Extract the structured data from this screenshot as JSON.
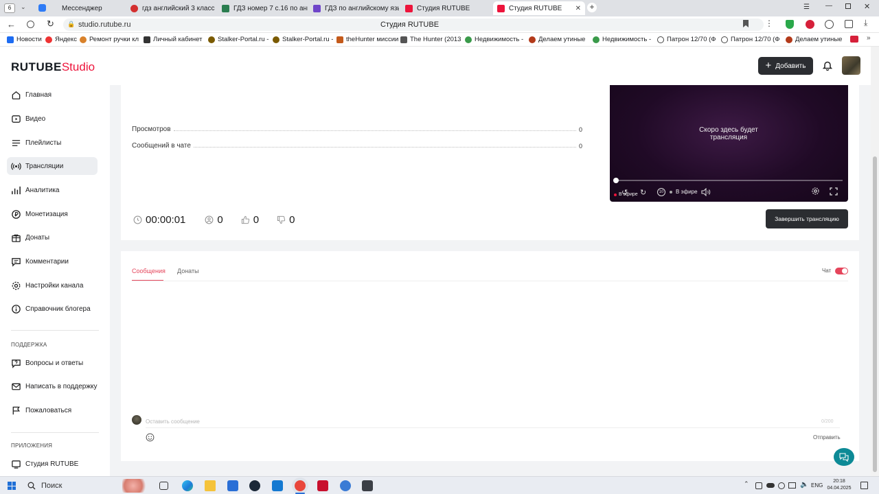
{
  "browser": {
    "tab_counter": "6",
    "tabs": [
      {
        "label": "Мессенджер",
        "color": "#2e7bf6"
      },
      {
        "label": "гдз английский 3 класс 2",
        "color": "#d32f2f"
      },
      {
        "label": "ГДЗ номер 7 с.16 по англ",
        "color": "#2a7d4f"
      },
      {
        "label": "ГДЗ по английскому язы",
        "color": "#6f45c9"
      },
      {
        "label": "Студия RUTUBE",
        "color": "#ed143b"
      },
      {
        "label": "Студия RUTUBE",
        "color": "#ed143b"
      }
    ],
    "url": "studio.rutube.ru",
    "page_title": "Студия RUTUBE",
    "bookmarks": [
      {
        "label": "Новости",
        "color": "#1d6cf2"
      },
      {
        "label": "Яндекс",
        "color": "#e33"
      },
      {
        "label": "Ремонт ручки кл",
        "color": "#d9822b"
      },
      {
        "label": "Личный кабинет",
        "color": "#333"
      },
      {
        "label": "Stalker-Portal.ru -",
        "color": "#7a5a00"
      },
      {
        "label": "Stalker-Portal.ru -",
        "color": "#7a5a00"
      },
      {
        "label": "theHunter миссии",
        "color": "#c45a1a"
      },
      {
        "label": "The Hunter (2013",
        "color": "#555"
      },
      {
        "label": "Недвижимость -",
        "color": "#3a9a4a"
      },
      {
        "label": "Делаем утиные",
        "color": "#b33a1a"
      },
      {
        "label": "Недвижимость -",
        "color": "#3a9a4a"
      },
      {
        "label": "Патрон 12/70 (Ф",
        "color": "#444"
      },
      {
        "label": "Патрон 12/70 (Ф",
        "color": "#444"
      },
      {
        "label": "Делаем утиные",
        "color": "#b33a1a"
      }
    ]
  },
  "header": {
    "logo_main": "RUTUBE",
    "logo_studio": "Studio",
    "add_button": "Добавить",
    "accent_color": "#ed143b"
  },
  "sidebar": {
    "items": [
      {
        "label": "Главная",
        "icon": "home-icon"
      },
      {
        "label": "Видео",
        "icon": "video-icon"
      },
      {
        "label": "Плейлисты",
        "icon": "playlist-icon"
      },
      {
        "label": "Трансляции",
        "icon": "broadcast-icon",
        "active": true
      },
      {
        "label": "Аналитика",
        "icon": "analytics-icon"
      },
      {
        "label": "Монетизация",
        "icon": "monetization-icon"
      },
      {
        "label": "Донаты",
        "icon": "donations-icon"
      },
      {
        "label": "Комментарии",
        "icon": "comments-icon"
      },
      {
        "label": "Настройки канала",
        "icon": "settings-icon"
      },
      {
        "label": "Справочник блогера",
        "icon": "info-icon"
      }
    ],
    "support_title": "ПОДДЕРЖКА",
    "support_items": [
      {
        "label": "Вопросы и ответы",
        "icon": "question-icon"
      },
      {
        "label": "Написать в поддержку",
        "icon": "mail-icon"
      },
      {
        "label": "Пожаловаться",
        "icon": "flag-icon"
      }
    ],
    "apps_title": "ПРИЛОЖЕНИЯ",
    "app_items": [
      {
        "label": "Студия RUTUBE",
        "icon": "studio-icon"
      }
    ]
  },
  "stream": {
    "views_label": "Просмотров",
    "views_value": "0",
    "chat_messages_label": "Сообщений в чате",
    "chat_messages_value": "0",
    "player_text": "Скоро здесь будет трансляция",
    "live_label": "В эфире",
    "live_control_label": "В эфире",
    "rewind_label": "10",
    "duration": "00:00:01",
    "viewers": "0",
    "likes": "0",
    "dislikes": "0",
    "end_button": "Завершить трансляцию"
  },
  "chat": {
    "tabs": [
      "Сообщения",
      "Донаты"
    ],
    "chat_toggle_label": "Чат",
    "chat_enabled": true,
    "input_placeholder": "Оставить сообщение",
    "char_counter": "0/200",
    "send_label": "Отправить"
  },
  "taskbar": {
    "search_label": "Поиск",
    "language": "ENG",
    "time": "20:18",
    "date": "04.04.2025"
  }
}
